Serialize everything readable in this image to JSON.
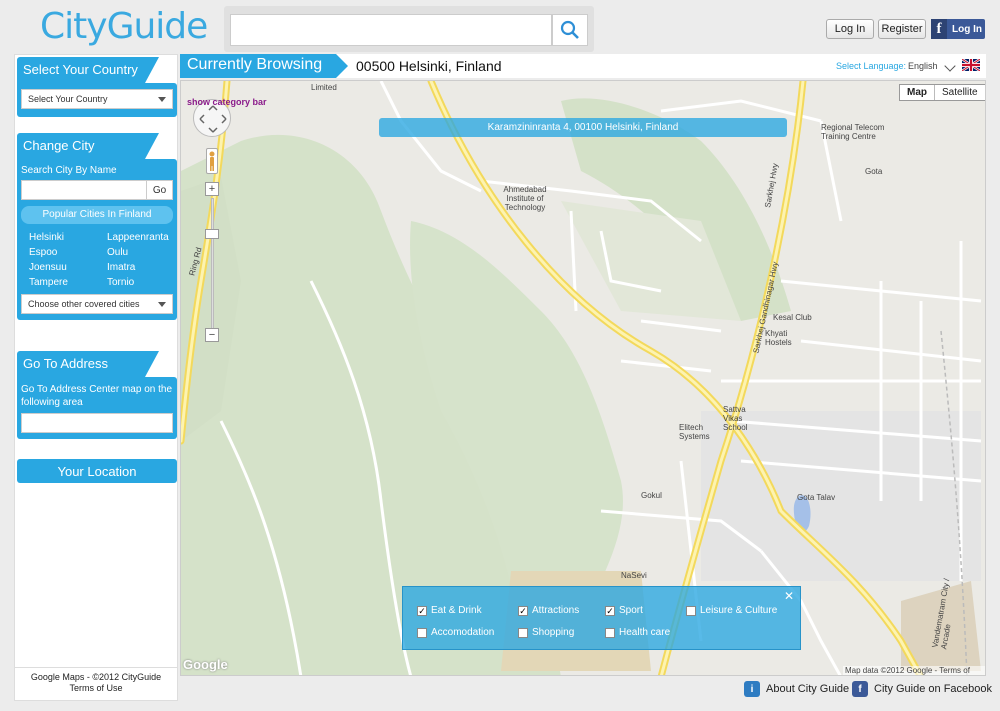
{
  "header": {
    "logo_part1": "City",
    "logo_part2": "Guide",
    "search_placeholder": "",
    "login_label": "Log In",
    "register_label": "Register",
    "fb_login_label": "Log In"
  },
  "sidebar": {
    "country_title": "Select Your Country",
    "country_select": "Select Your Country",
    "city_title": "Change City",
    "search_city_label": "Search City By Name",
    "go_label": "Go",
    "popular_title": "Popular Cities In Finland",
    "cities": [
      "Helsinki",
      "Lappeenranta",
      "Espoo",
      "Oulu",
      "Joensuu",
      "Imatra",
      "Tampere",
      "Tornio"
    ],
    "other_cities_select": "Choose other covered cities",
    "address_title": "Go To Address",
    "address_desc": "Go To Address Center map on the following area",
    "your_location": "Your Location",
    "footer_line1": "Google Maps - ©2012 CityGuide",
    "footer_line2": "Terms of Use"
  },
  "browse": {
    "tab_label": "Currently Browsing",
    "location": "00500 Helsinki, Finland",
    "language_label": "Select Language:",
    "language_value": "English"
  },
  "map": {
    "address_banner": "Karamzininranta 4, 00100 Helsinki, Finland",
    "type_map": "Map",
    "type_satellite": "Satellite",
    "show_category": "show category bar",
    "google_logo": "Google",
    "credit": "Map data ©2012 Google - Terms of Use",
    "labels": {
      "limited": "Limited",
      "regional_telecom": "Regional Telecom Training Centre",
      "gota": "Gota",
      "ahmedabad": "Ahmedabad Institute of Technology",
      "kesal_club": "Kesal Club",
      "khyati": "Khyati Hostels",
      "sattva": "Sattva Vikas School",
      "elitech": "Elitech Systems",
      "gokul": "Gokul",
      "gota_talav": "Gota Talav",
      "ring_rd": "Ring Rd",
      "sarkhej_gandhinagar": "Sarkhej Gandhinagar Hwy",
      "sarkhej": "Sarkhej Hwy",
      "vandematram": "Vandematram City / Arcade",
      "navsrushti": "NaSevi",
      "road_8c": "8C"
    }
  },
  "categories": {
    "items": [
      {
        "label": "Eat & Drink",
        "checked": true
      },
      {
        "label": "Attractions",
        "checked": true
      },
      {
        "label": "Sport",
        "checked": true
      },
      {
        "label": "Leisure & Culture",
        "checked": false
      },
      {
        "label": "Accomodation",
        "checked": false
      },
      {
        "label": "Shopping",
        "checked": false
      },
      {
        "label": "Health care",
        "checked": false
      }
    ],
    "check_mark": "✓"
  },
  "footer": {
    "about_label": "About City Guide",
    "facebook_label": "City Guide on Facebook"
  },
  "colors": {
    "accent": "#29a7e1",
    "road_major": "#f7e26b",
    "park": "#d5e2c9"
  }
}
